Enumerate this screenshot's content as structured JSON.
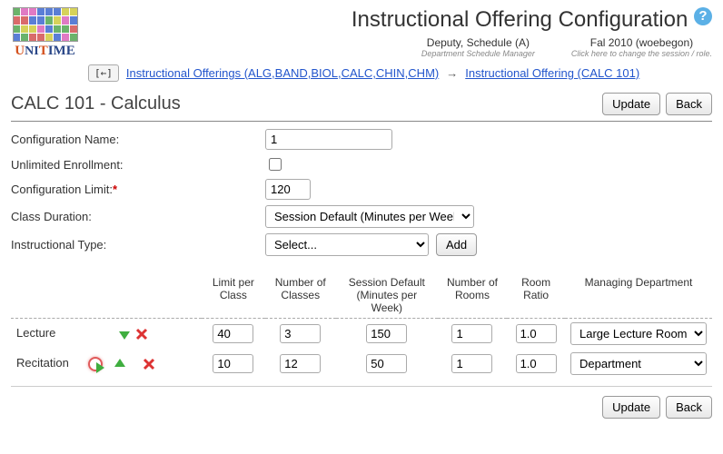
{
  "page": {
    "title": "Instructional Offering Configuration",
    "user_name": "Deputy, Schedule (A)",
    "user_role": "Department Schedule Manager",
    "session_label": "Fal 2010 (woebegon)",
    "session_hint": "Click here to change the session / role."
  },
  "breadcrumb": {
    "bc1": "Instructional Offerings (ALG,BAND,BIOL,CALC,CHIN,CHM)",
    "bc2": "Instructional Offering (CALC 101)"
  },
  "heading": "CALC 101 - Calculus",
  "buttons": {
    "update": "Update",
    "back": "Back",
    "add": "Add"
  },
  "form": {
    "config_name_label": "Configuration Name:",
    "config_name_value": "1",
    "unlimited_label": "Unlimited Enrollment:",
    "config_limit_label": "Configuration Limit:",
    "config_limit_value": "120",
    "class_duration_label": "Class Duration:",
    "class_duration_value": "Session Default (Minutes per Week)",
    "instr_type_label": "Instructional Type:",
    "instr_type_value": "Select..."
  },
  "table": {
    "headers": {
      "limit": "Limit per Class",
      "num_classes": "Number of Classes",
      "session_default": "Session Default (Minutes per Week)",
      "num_rooms": "Number of Rooms",
      "room_ratio": "Room Ratio",
      "manage_dept": "Managing Department"
    },
    "rows": [
      {
        "label": "Lecture",
        "limit": "40",
        "num_classes": "3",
        "session_default": "150",
        "num_rooms": "1",
        "room_ratio": "1.0",
        "manage_dept": "Large Lecture Room"
      },
      {
        "label": "Recitation",
        "limit": "10",
        "num_classes": "12",
        "session_default": "50",
        "num_rooms": "1",
        "room_ratio": "1.0",
        "manage_dept": "Department"
      }
    ]
  }
}
